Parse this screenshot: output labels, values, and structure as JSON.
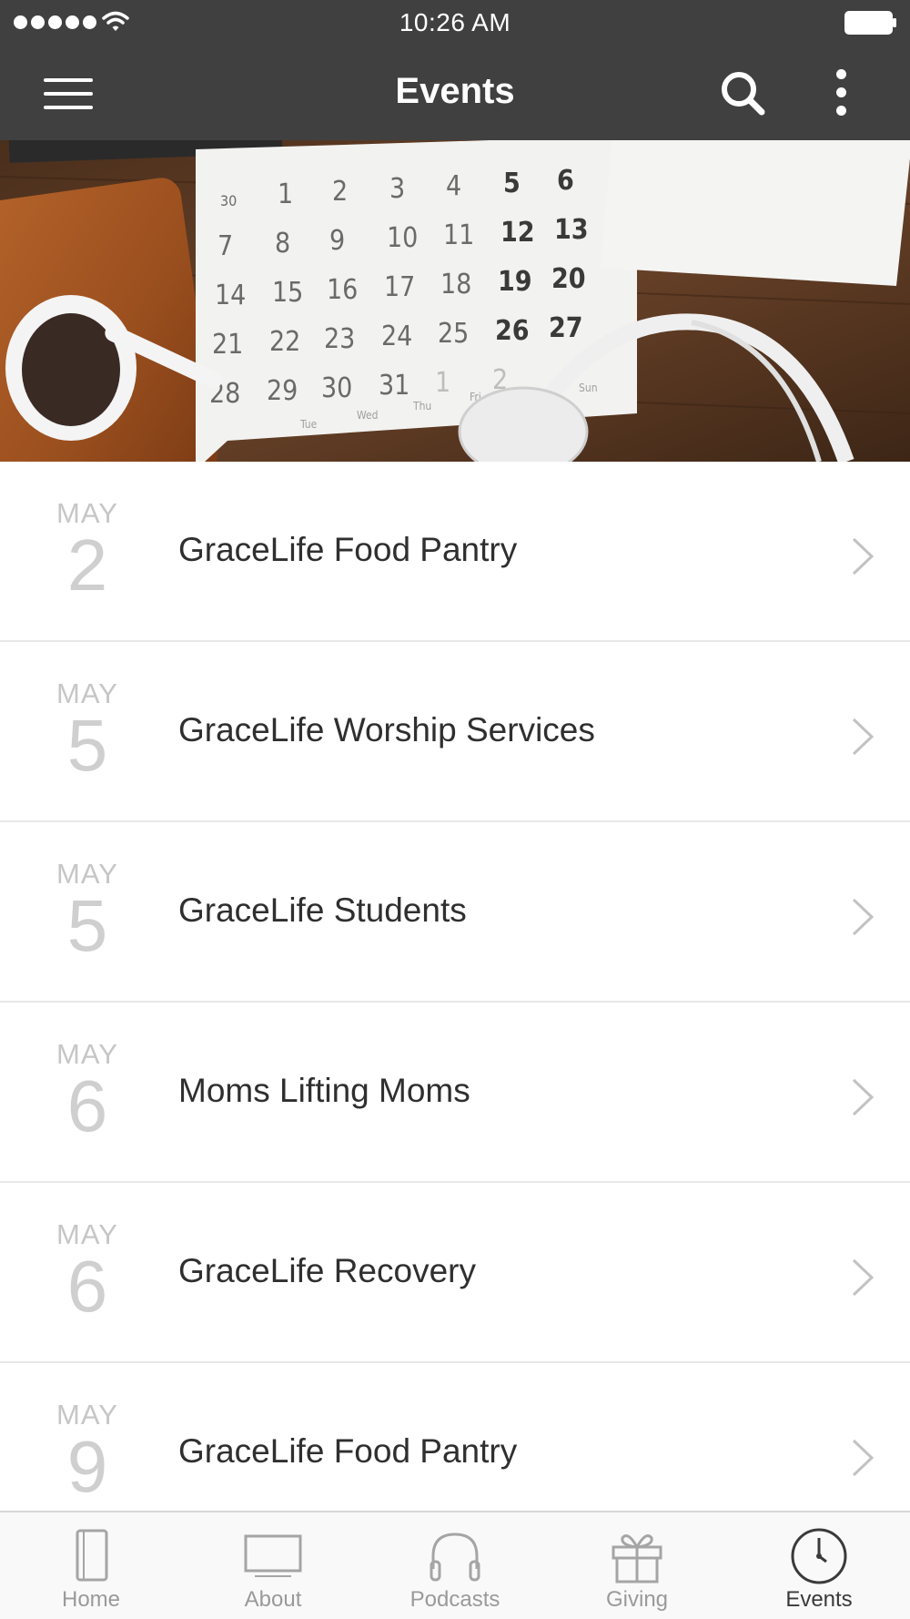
{
  "status_bar": {
    "time": "10:26 AM",
    "signal_dots": 5,
    "wifi_icon": "wifi-icon",
    "battery_icon": "battery-full-icon"
  },
  "nav": {
    "title": "Events",
    "menu_icon": "hamburger-menu-icon",
    "search_icon": "search-icon",
    "more_icon": "more-vertical-icon"
  },
  "hero": {
    "calendar_weekdays": [
      "Tue",
      "Wed",
      "Thu",
      "Fri",
      "Sun"
    ],
    "calendar_rows": [
      [
        "30",
        "1",
        "2",
        "3",
        "4",
        "5",
        "6"
      ],
      [
        "7",
        "8",
        "9",
        "10",
        "11",
        "12",
        "13"
      ],
      [
        "14",
        "15",
        "16",
        "17",
        "18",
        "19",
        "20"
      ],
      [
        "21",
        "22",
        "23",
        "24",
        "25",
        "26",
        "27"
      ],
      [
        "28",
        "29",
        "30",
        "31",
        "1",
        "2",
        ""
      ]
    ]
  },
  "events": [
    {
      "month": "MAY",
      "day": "2",
      "title": "GraceLife Food Pantry"
    },
    {
      "month": "MAY",
      "day": "5",
      "title": "GraceLife Worship Services"
    },
    {
      "month": "MAY",
      "day": "5",
      "title": "GraceLife Students"
    },
    {
      "month": "MAY",
      "day": "6",
      "title": "Moms Lifting Moms"
    },
    {
      "month": "MAY",
      "day": "6",
      "title": "GraceLife Recovery"
    },
    {
      "month": "MAY",
      "day": "9",
      "title": "GraceLife Food Pantry"
    }
  ],
  "tabs": [
    {
      "label": "Home",
      "icon": "book-icon",
      "active": false
    },
    {
      "label": "About",
      "icon": "monitor-icon",
      "active": false
    },
    {
      "label": "Podcasts",
      "icon": "headphones-icon",
      "active": false
    },
    {
      "label": "Giving",
      "icon": "gift-icon",
      "active": false
    },
    {
      "label": "Events",
      "icon": "clock-icon",
      "active": true
    }
  ],
  "colors": {
    "nav_background": "#404040",
    "tab_active": "#3a3a3a",
    "tab_inactive": "#9a9a9a",
    "date_text": "#c6c6c6"
  }
}
